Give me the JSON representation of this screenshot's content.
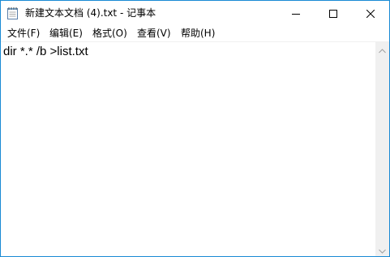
{
  "window": {
    "title": "新建文本文档 (4).txt - 记事本"
  },
  "menu": {
    "items": [
      {
        "label": "文件(F)"
      },
      {
        "label": "编辑(E)"
      },
      {
        "label": "格式(O)"
      },
      {
        "label": "查看(V)"
      },
      {
        "label": "帮助(H)"
      }
    ]
  },
  "editor": {
    "content": "dir *.* /b >list.txt"
  },
  "colors": {
    "border": "#1a8ad4",
    "scrollbar_track": "#f0f0f0"
  },
  "icons": {
    "app": "notepad-icon",
    "minimize": "minimize-icon",
    "maximize": "maximize-icon",
    "close": "close-icon"
  }
}
